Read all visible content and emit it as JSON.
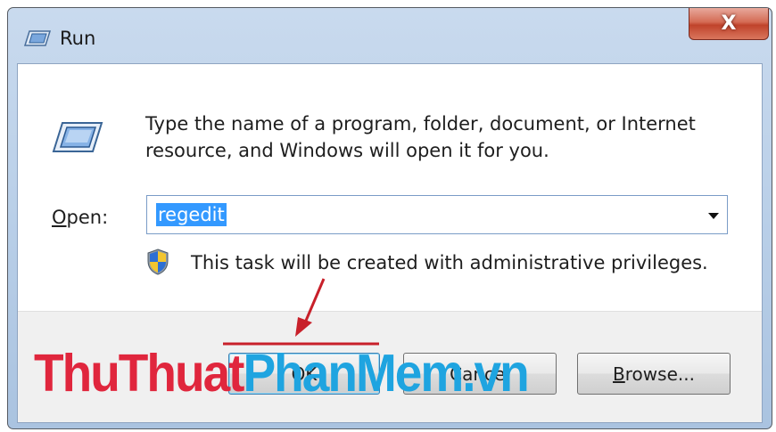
{
  "window": {
    "title": "Run",
    "close_label": "X"
  },
  "dialog": {
    "description": "Type the name of a program, folder, document, or Internet resource, and Windows will open it for you.",
    "open_label_prefix": "O",
    "open_label_rest": "pen:",
    "open_value": "regedit",
    "admin_note": "This task will be created with administrative privileges."
  },
  "buttons": {
    "ok_label": "OK",
    "cancel_label": "Cancel",
    "browse_label_prefix": "B",
    "browse_label_rest": "rowse..."
  },
  "watermark": {
    "part1": "ThuThuat",
    "part2": "PhanMem",
    "part3": ".vn"
  },
  "icons": {
    "title": "run-icon",
    "main": "run-icon",
    "shield": "uac-shield-icon",
    "dropdown": "chevron-down-icon",
    "annotation": "red-arrow-icon"
  },
  "colors": {
    "selection": "#3399ff",
    "close_button": "#c0432b",
    "watermark_red": "#e0263d",
    "watermark_blue": "#1fa4e0",
    "arrow": "#c8202a"
  }
}
